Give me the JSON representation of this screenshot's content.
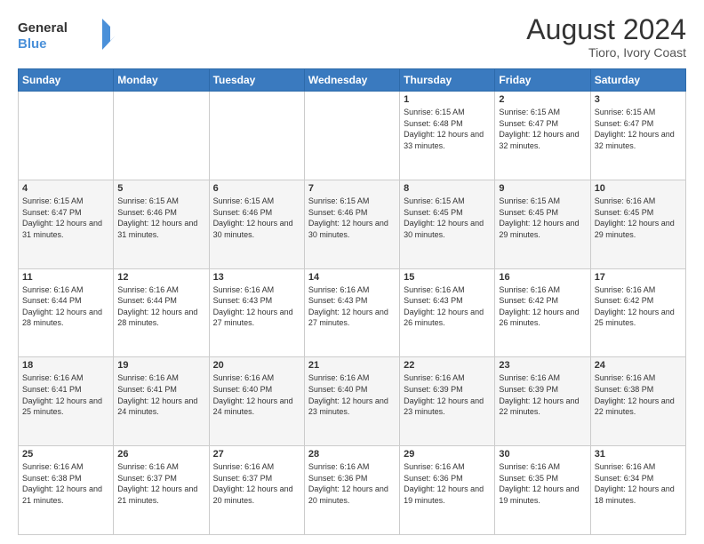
{
  "logo": {
    "line1": "General",
    "line2": "Blue"
  },
  "title": "August 2024",
  "subtitle": "Tioro, Ivory Coast",
  "days_header": [
    "Sunday",
    "Monday",
    "Tuesday",
    "Wednesday",
    "Thursday",
    "Friday",
    "Saturday"
  ],
  "weeks": [
    [
      {
        "day": "",
        "info": ""
      },
      {
        "day": "",
        "info": ""
      },
      {
        "day": "",
        "info": ""
      },
      {
        "day": "",
        "info": ""
      },
      {
        "day": "1",
        "info": "Sunrise: 6:15 AM\nSunset: 6:48 PM\nDaylight: 12 hours\nand 33 minutes."
      },
      {
        "day": "2",
        "info": "Sunrise: 6:15 AM\nSunset: 6:47 PM\nDaylight: 12 hours\nand 32 minutes."
      },
      {
        "day": "3",
        "info": "Sunrise: 6:15 AM\nSunset: 6:47 PM\nDaylight: 12 hours\nand 32 minutes."
      }
    ],
    [
      {
        "day": "4",
        "info": "Sunrise: 6:15 AM\nSunset: 6:47 PM\nDaylight: 12 hours\nand 31 minutes."
      },
      {
        "day": "5",
        "info": "Sunrise: 6:15 AM\nSunset: 6:46 PM\nDaylight: 12 hours\nand 31 minutes."
      },
      {
        "day": "6",
        "info": "Sunrise: 6:15 AM\nSunset: 6:46 PM\nDaylight: 12 hours\nand 30 minutes."
      },
      {
        "day": "7",
        "info": "Sunrise: 6:15 AM\nSunset: 6:46 PM\nDaylight: 12 hours\nand 30 minutes."
      },
      {
        "day": "8",
        "info": "Sunrise: 6:15 AM\nSunset: 6:45 PM\nDaylight: 12 hours\nand 30 minutes."
      },
      {
        "day": "9",
        "info": "Sunrise: 6:15 AM\nSunset: 6:45 PM\nDaylight: 12 hours\nand 29 minutes."
      },
      {
        "day": "10",
        "info": "Sunrise: 6:16 AM\nSunset: 6:45 PM\nDaylight: 12 hours\nand 29 minutes."
      }
    ],
    [
      {
        "day": "11",
        "info": "Sunrise: 6:16 AM\nSunset: 6:44 PM\nDaylight: 12 hours\nand 28 minutes."
      },
      {
        "day": "12",
        "info": "Sunrise: 6:16 AM\nSunset: 6:44 PM\nDaylight: 12 hours\nand 28 minutes."
      },
      {
        "day": "13",
        "info": "Sunrise: 6:16 AM\nSunset: 6:43 PM\nDaylight: 12 hours\nand 27 minutes."
      },
      {
        "day": "14",
        "info": "Sunrise: 6:16 AM\nSunset: 6:43 PM\nDaylight: 12 hours\nand 27 minutes."
      },
      {
        "day": "15",
        "info": "Sunrise: 6:16 AM\nSunset: 6:43 PM\nDaylight: 12 hours\nand 26 minutes."
      },
      {
        "day": "16",
        "info": "Sunrise: 6:16 AM\nSunset: 6:42 PM\nDaylight: 12 hours\nand 26 minutes."
      },
      {
        "day": "17",
        "info": "Sunrise: 6:16 AM\nSunset: 6:42 PM\nDaylight: 12 hours\nand 25 minutes."
      }
    ],
    [
      {
        "day": "18",
        "info": "Sunrise: 6:16 AM\nSunset: 6:41 PM\nDaylight: 12 hours\nand 25 minutes."
      },
      {
        "day": "19",
        "info": "Sunrise: 6:16 AM\nSunset: 6:41 PM\nDaylight: 12 hours\nand 24 minutes."
      },
      {
        "day": "20",
        "info": "Sunrise: 6:16 AM\nSunset: 6:40 PM\nDaylight: 12 hours\nand 24 minutes."
      },
      {
        "day": "21",
        "info": "Sunrise: 6:16 AM\nSunset: 6:40 PM\nDaylight: 12 hours\nand 23 minutes."
      },
      {
        "day": "22",
        "info": "Sunrise: 6:16 AM\nSunset: 6:39 PM\nDaylight: 12 hours\nand 23 minutes."
      },
      {
        "day": "23",
        "info": "Sunrise: 6:16 AM\nSunset: 6:39 PM\nDaylight: 12 hours\nand 22 minutes."
      },
      {
        "day": "24",
        "info": "Sunrise: 6:16 AM\nSunset: 6:38 PM\nDaylight: 12 hours\nand 22 minutes."
      }
    ],
    [
      {
        "day": "25",
        "info": "Sunrise: 6:16 AM\nSunset: 6:38 PM\nDaylight: 12 hours\nand 21 minutes."
      },
      {
        "day": "26",
        "info": "Sunrise: 6:16 AM\nSunset: 6:37 PM\nDaylight: 12 hours\nand 21 minutes."
      },
      {
        "day": "27",
        "info": "Sunrise: 6:16 AM\nSunset: 6:37 PM\nDaylight: 12 hours\nand 20 minutes."
      },
      {
        "day": "28",
        "info": "Sunrise: 6:16 AM\nSunset: 6:36 PM\nDaylight: 12 hours\nand 20 minutes."
      },
      {
        "day": "29",
        "info": "Sunrise: 6:16 AM\nSunset: 6:36 PM\nDaylight: 12 hours\nand 19 minutes."
      },
      {
        "day": "30",
        "info": "Sunrise: 6:16 AM\nSunset: 6:35 PM\nDaylight: 12 hours\nand 19 minutes."
      },
      {
        "day": "31",
        "info": "Sunrise: 6:16 AM\nSunset: 6:34 PM\nDaylight: 12 hours\nand 18 minutes."
      }
    ]
  ]
}
